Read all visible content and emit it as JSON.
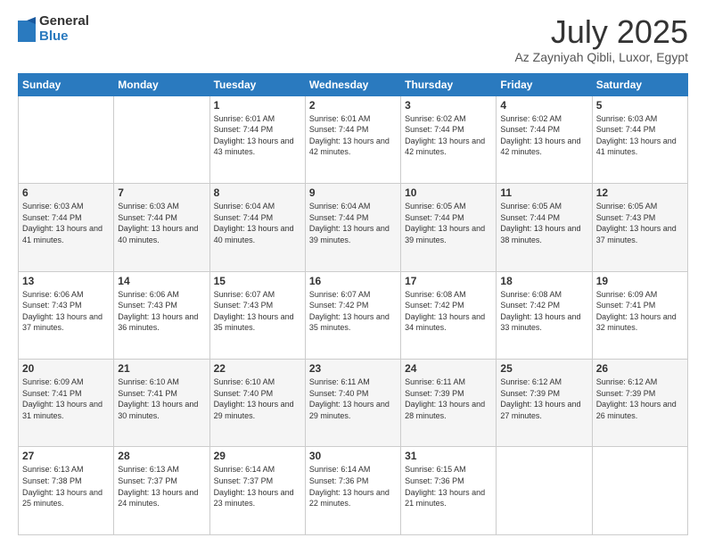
{
  "header": {
    "logo_general": "General",
    "logo_blue": "Blue",
    "month_title": "July 2025",
    "subtitle": "Az Zayniyah Qibli, Luxor, Egypt"
  },
  "days_of_week": [
    "Sunday",
    "Monday",
    "Tuesday",
    "Wednesday",
    "Thursday",
    "Friday",
    "Saturday"
  ],
  "weeks": [
    [
      {
        "day": "",
        "info": ""
      },
      {
        "day": "",
        "info": ""
      },
      {
        "day": "1",
        "info": "Sunrise: 6:01 AM\nSunset: 7:44 PM\nDaylight: 13 hours and 43 minutes."
      },
      {
        "day": "2",
        "info": "Sunrise: 6:01 AM\nSunset: 7:44 PM\nDaylight: 13 hours and 42 minutes."
      },
      {
        "day": "3",
        "info": "Sunrise: 6:02 AM\nSunset: 7:44 PM\nDaylight: 13 hours and 42 minutes."
      },
      {
        "day": "4",
        "info": "Sunrise: 6:02 AM\nSunset: 7:44 PM\nDaylight: 13 hours and 42 minutes."
      },
      {
        "day": "5",
        "info": "Sunrise: 6:03 AM\nSunset: 7:44 PM\nDaylight: 13 hours and 41 minutes."
      }
    ],
    [
      {
        "day": "6",
        "info": "Sunrise: 6:03 AM\nSunset: 7:44 PM\nDaylight: 13 hours and 41 minutes."
      },
      {
        "day": "7",
        "info": "Sunrise: 6:03 AM\nSunset: 7:44 PM\nDaylight: 13 hours and 40 minutes."
      },
      {
        "day": "8",
        "info": "Sunrise: 6:04 AM\nSunset: 7:44 PM\nDaylight: 13 hours and 40 minutes."
      },
      {
        "day": "9",
        "info": "Sunrise: 6:04 AM\nSunset: 7:44 PM\nDaylight: 13 hours and 39 minutes."
      },
      {
        "day": "10",
        "info": "Sunrise: 6:05 AM\nSunset: 7:44 PM\nDaylight: 13 hours and 39 minutes."
      },
      {
        "day": "11",
        "info": "Sunrise: 6:05 AM\nSunset: 7:44 PM\nDaylight: 13 hours and 38 minutes."
      },
      {
        "day": "12",
        "info": "Sunrise: 6:05 AM\nSunset: 7:43 PM\nDaylight: 13 hours and 37 minutes."
      }
    ],
    [
      {
        "day": "13",
        "info": "Sunrise: 6:06 AM\nSunset: 7:43 PM\nDaylight: 13 hours and 37 minutes."
      },
      {
        "day": "14",
        "info": "Sunrise: 6:06 AM\nSunset: 7:43 PM\nDaylight: 13 hours and 36 minutes."
      },
      {
        "day": "15",
        "info": "Sunrise: 6:07 AM\nSunset: 7:43 PM\nDaylight: 13 hours and 35 minutes."
      },
      {
        "day": "16",
        "info": "Sunrise: 6:07 AM\nSunset: 7:42 PM\nDaylight: 13 hours and 35 minutes."
      },
      {
        "day": "17",
        "info": "Sunrise: 6:08 AM\nSunset: 7:42 PM\nDaylight: 13 hours and 34 minutes."
      },
      {
        "day": "18",
        "info": "Sunrise: 6:08 AM\nSunset: 7:42 PM\nDaylight: 13 hours and 33 minutes."
      },
      {
        "day": "19",
        "info": "Sunrise: 6:09 AM\nSunset: 7:41 PM\nDaylight: 13 hours and 32 minutes."
      }
    ],
    [
      {
        "day": "20",
        "info": "Sunrise: 6:09 AM\nSunset: 7:41 PM\nDaylight: 13 hours and 31 minutes."
      },
      {
        "day": "21",
        "info": "Sunrise: 6:10 AM\nSunset: 7:41 PM\nDaylight: 13 hours and 30 minutes."
      },
      {
        "day": "22",
        "info": "Sunrise: 6:10 AM\nSunset: 7:40 PM\nDaylight: 13 hours and 29 minutes."
      },
      {
        "day": "23",
        "info": "Sunrise: 6:11 AM\nSunset: 7:40 PM\nDaylight: 13 hours and 29 minutes."
      },
      {
        "day": "24",
        "info": "Sunrise: 6:11 AM\nSunset: 7:39 PM\nDaylight: 13 hours and 28 minutes."
      },
      {
        "day": "25",
        "info": "Sunrise: 6:12 AM\nSunset: 7:39 PM\nDaylight: 13 hours and 27 minutes."
      },
      {
        "day": "26",
        "info": "Sunrise: 6:12 AM\nSunset: 7:39 PM\nDaylight: 13 hours and 26 minutes."
      }
    ],
    [
      {
        "day": "27",
        "info": "Sunrise: 6:13 AM\nSunset: 7:38 PM\nDaylight: 13 hours and 25 minutes."
      },
      {
        "day": "28",
        "info": "Sunrise: 6:13 AM\nSunset: 7:37 PM\nDaylight: 13 hours and 24 minutes."
      },
      {
        "day": "29",
        "info": "Sunrise: 6:14 AM\nSunset: 7:37 PM\nDaylight: 13 hours and 23 minutes."
      },
      {
        "day": "30",
        "info": "Sunrise: 6:14 AM\nSunset: 7:36 PM\nDaylight: 13 hours and 22 minutes."
      },
      {
        "day": "31",
        "info": "Sunrise: 6:15 AM\nSunset: 7:36 PM\nDaylight: 13 hours and 21 minutes."
      },
      {
        "day": "",
        "info": ""
      },
      {
        "day": "",
        "info": ""
      }
    ]
  ]
}
